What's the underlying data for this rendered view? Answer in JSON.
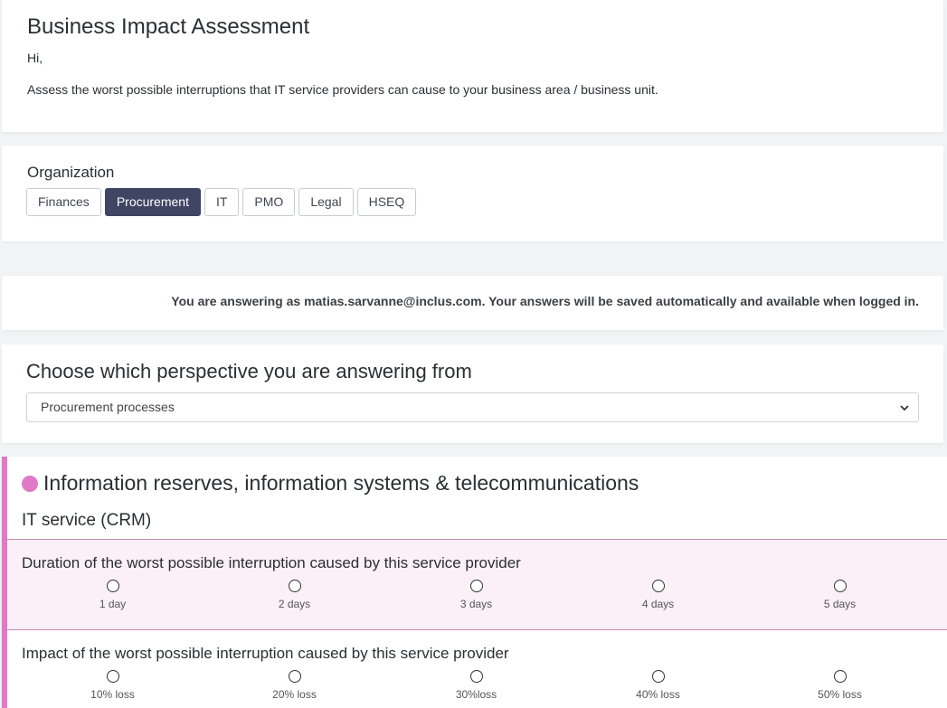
{
  "header": {
    "title": "Business Impact Assessment",
    "greeting": "Hi,",
    "intro": "Assess the worst possible interruptions that IT service providers can cause to your business area / business unit."
  },
  "organization": {
    "label": "Organization",
    "tabs": [
      "Finances",
      "Procurement",
      "IT",
      "PMO",
      "Legal",
      "HSEQ"
    ],
    "active": "Procurement"
  },
  "notice": "You are answering as matias.sarvanne@inclus.com. Your answers will be saved automatically and available when logged in.",
  "perspective": {
    "title": "Choose which perspective you are answering from",
    "selected": "Procurement processes"
  },
  "category": {
    "color": "#e079c6",
    "title": "Information reserves, information systems & telecommunications",
    "service": "IT service (CRM)",
    "questions": [
      {
        "title": "Duration of the worst possible interruption caused by this service provider",
        "options": [
          "1 day",
          "2 days",
          "3 days",
          "4 days",
          "5 days"
        ]
      },
      {
        "title": "Impact of the worst possible interruption caused by this service provider",
        "options": [
          "10% loss",
          "20% loss",
          "30%loss",
          "40% loss",
          "50% loss"
        ]
      }
    ]
  }
}
